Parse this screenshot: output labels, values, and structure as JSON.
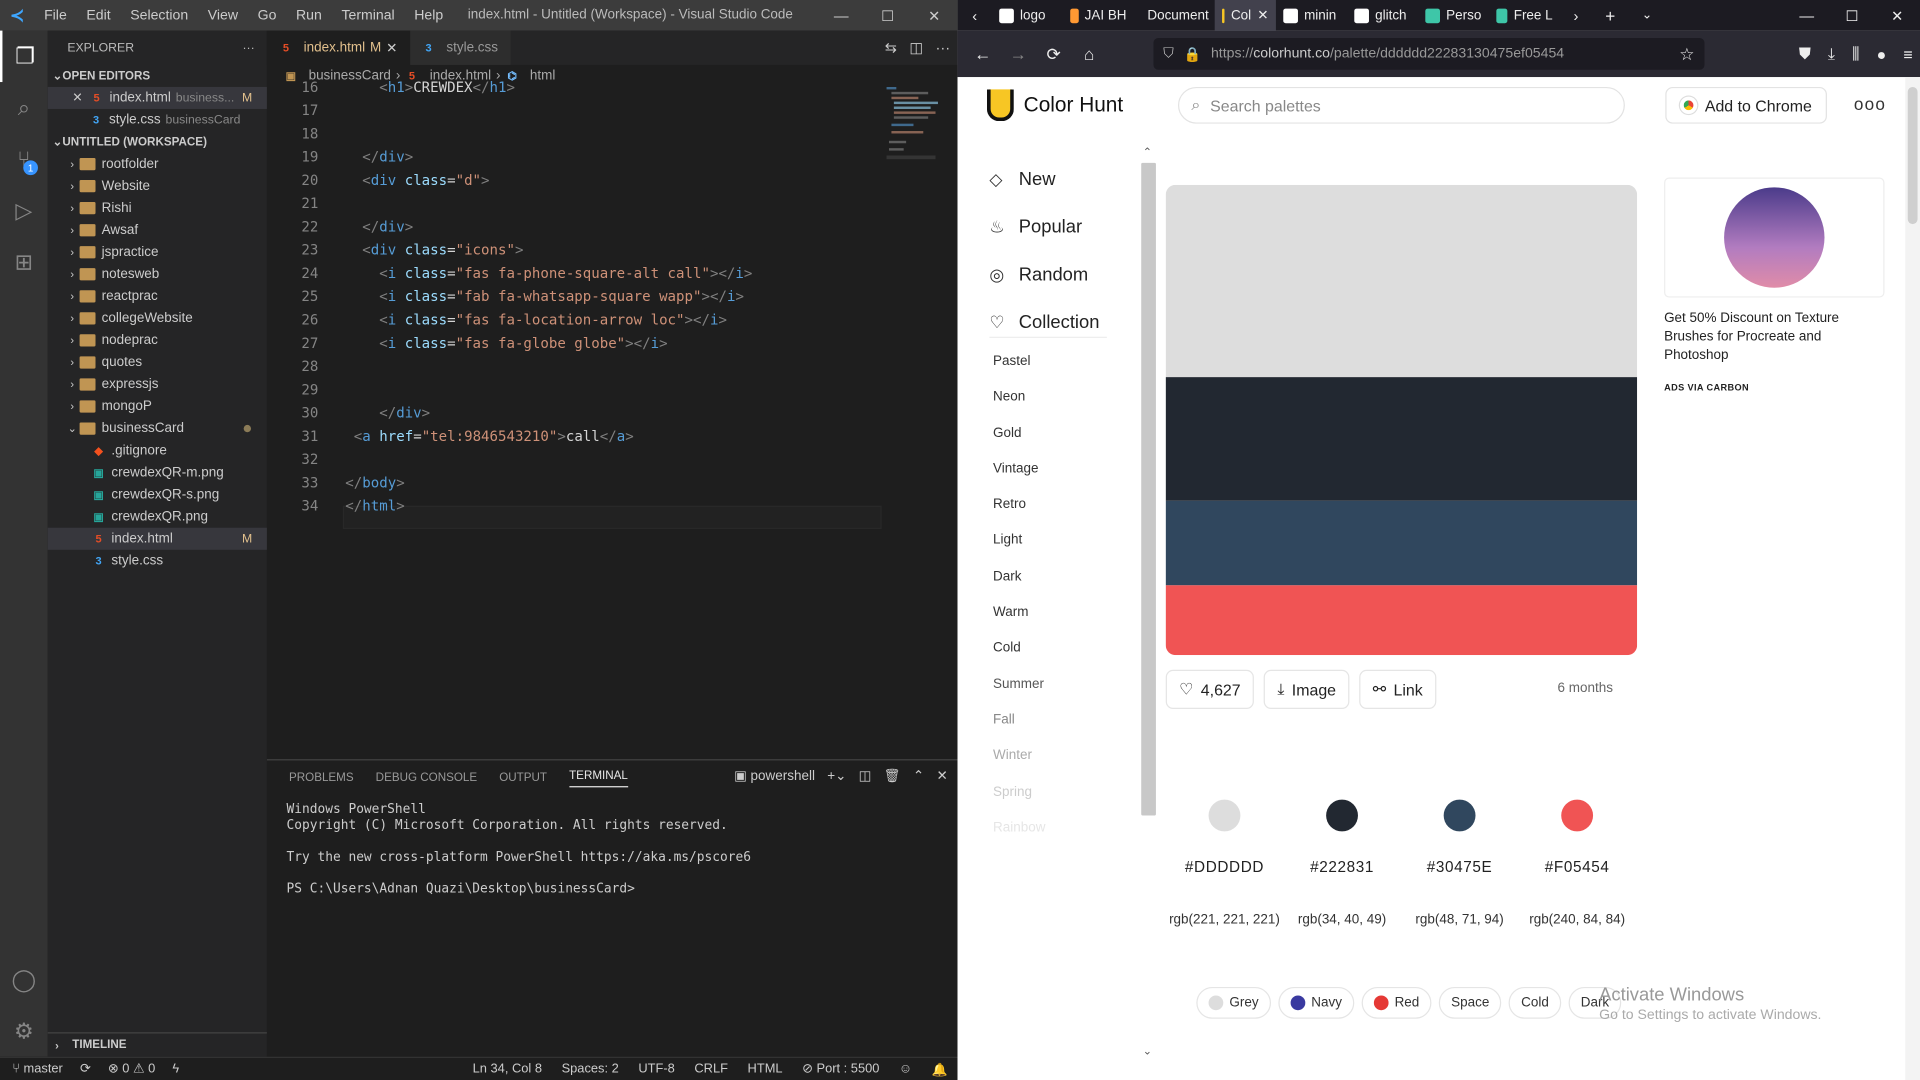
{
  "vscode": {
    "menu": [
      "File",
      "Edit",
      "Selection",
      "View",
      "Go",
      "Run",
      "Terminal",
      "Help"
    ],
    "window_title": "index.html - Untitled (Workspace) - Visual Studio Code",
    "explorer_title": "EXPLORER",
    "open_editors_label": "OPEN EDITORS",
    "open_editors": [
      {
        "name": "index.html",
        "desc": "business...",
        "status": "M"
      },
      {
        "name": "style.css",
        "desc": "businessCard",
        "status": ""
      }
    ],
    "workspace_label": "UNTITLED (WORKSPACE)",
    "folders": [
      "rootfolder",
      "Website",
      "Rishi",
      "Awsaf",
      "jspractice",
      "notesweb",
      "reactprac",
      "collegeWebsite",
      "nodeprac",
      "quotes",
      "expressjs",
      "mongoP"
    ],
    "open_folder": "businessCard",
    "files": [
      {
        "name": ".gitignore",
        "status": ""
      },
      {
        "name": "crewdexQR-m.png",
        "status": ""
      },
      {
        "name": "crewdexQR-s.png",
        "status": ""
      },
      {
        "name": "crewdexQR.png",
        "status": ""
      },
      {
        "name": "index.html",
        "status": "M"
      },
      {
        "name": "style.css",
        "status": ""
      }
    ],
    "timeline_label": "TIMELINE",
    "tabs": [
      {
        "label": "index.html",
        "status": "M"
      },
      {
        "label": "style.css",
        "status": ""
      }
    ],
    "breadcrumb": [
      "businessCard",
      "index.html",
      "html"
    ],
    "code_lines": [
      {
        "n": "16",
        "t": "    <h1>CREWDEX</h1>"
      },
      {
        "n": "17",
        "t": ""
      },
      {
        "n": "18",
        "t": ""
      },
      {
        "n": "19",
        "t": "  </div>"
      },
      {
        "n": "20",
        "t": "  <div class=\"d\">"
      },
      {
        "n": "21",
        "t": ""
      },
      {
        "n": "22",
        "t": "  </div>"
      },
      {
        "n": "23",
        "t": "  <div class=\"icons\">"
      },
      {
        "n": "24",
        "t": "    <i class=\"fas fa-phone-square-alt call\"></i>"
      },
      {
        "n": "25",
        "t": "    <i class=\"fab fa-whatsapp-square wapp\"></i>"
      },
      {
        "n": "26",
        "t": "    <i class=\"fas fa-location-arrow loc\"></i>"
      },
      {
        "n": "27",
        "t": "    <i class=\"fas fa-globe globe\"></i>"
      },
      {
        "n": "28",
        "t": ""
      },
      {
        "n": "29",
        "t": ""
      },
      {
        "n": "30",
        "t": "    </div>"
      },
      {
        "n": "31",
        "t": " <a href=\"tel:9846543210\">call</a>"
      },
      {
        "n": "32",
        "t": ""
      },
      {
        "n": "33",
        "t": "</body>"
      },
      {
        "n": "34",
        "t": "</html>"
      }
    ],
    "panel_tabs": [
      "PROBLEMS",
      "DEBUG CONSOLE",
      "OUTPUT",
      "TERMINAL"
    ],
    "active_panel_tab": "TERMINAL",
    "shell": "powershell",
    "terminal_lines": [
      "Windows PowerShell",
      "Copyright (C) Microsoft Corporation. All rights reserved.",
      "",
      "Try the new cross-platform PowerShell https://aka.ms/pscore6",
      "",
      "PS C:\\Users\\Adnan Quazi\\Desktop\\businessCard> "
    ],
    "status": {
      "branch": "master",
      "problems": "0",
      "warnings": "0",
      "position": "Ln 34, Col 8",
      "spaces": "Spaces: 2",
      "encoding": "UTF-8",
      "eol": "CRLF",
      "language": "HTML",
      "port": "Port : 5500"
    },
    "scm_badge": "1"
  },
  "firefox": {
    "tabs": [
      {
        "label": "logo",
        "color": "#ffffff"
      },
      {
        "label": "JAI BH",
        "color": "#ff9933"
      },
      {
        "label": "Document",
        "color": ""
      },
      {
        "label": "Col",
        "color": "#f7c624"
      },
      {
        "label": "minin",
        "color": "#ffffff"
      },
      {
        "label": "glitch",
        "color": "#ffffff"
      },
      {
        "label": "Perso",
        "color": "#3ec6a8"
      },
      {
        "label": "Free L",
        "color": "#3ec6a8"
      }
    ],
    "url_prefix": "https://",
    "url_host": "colorhunt.co",
    "url_path": "/palette/dddddd22283130475ef05454"
  },
  "colorhunt": {
    "brand": "Color Hunt",
    "search_placeholder": "Search palettes",
    "add_to_chrome": "Add to Chrome",
    "nav": [
      {
        "label": "New",
        "icon": "diamond-icon"
      },
      {
        "label": "Popular",
        "icon": "flame-icon"
      },
      {
        "label": "Random",
        "icon": "spiral-icon"
      },
      {
        "label": "Collection",
        "icon": "heart-icon"
      }
    ],
    "tags": [
      {
        "label": "Pastel",
        "color": "#333333"
      },
      {
        "label": "Neon",
        "color": "#333333"
      },
      {
        "label": "Gold",
        "color": "#333333"
      },
      {
        "label": "Vintage",
        "color": "#333333"
      },
      {
        "label": "Retro",
        "color": "#333333"
      },
      {
        "label": "Light",
        "color": "#333333"
      },
      {
        "label": "Dark",
        "color": "#333333"
      },
      {
        "label": "Warm",
        "color": "#333333"
      },
      {
        "label": "Cold",
        "color": "#333333"
      },
      {
        "label": "Summer",
        "color": "#555555"
      },
      {
        "label": "Fall",
        "color": "#888888"
      },
      {
        "label": "Winter",
        "color": "#aaaaaa"
      },
      {
        "label": "Spring",
        "color": "#cccccc"
      },
      {
        "label": "Rainbow",
        "color": "#e6e6e6"
      }
    ],
    "palette": [
      "#DDDDDD",
      "#222831",
      "#30475E",
      "#F05454"
    ],
    "likes": "4,627",
    "image_label": "Image",
    "link_label": "Link",
    "age": "6 months",
    "colors": [
      {
        "hex": "#DDDDDD",
        "rgb": "rgb(221, 221, 221)"
      },
      {
        "hex": "#222831",
        "rgb": "rgb(34, 40, 49)"
      },
      {
        "hex": "#30475E",
        "rgb": "rgb(48, 71, 94)"
      },
      {
        "hex": "#F05454",
        "rgb": "rgb(240, 84, 84)"
      }
    ],
    "chips": [
      {
        "label": "Grey",
        "color": "#dddddd"
      },
      {
        "label": "Navy",
        "color": "#3a3aa0"
      },
      {
        "label": "Red",
        "color": "#e53935"
      },
      {
        "label": "Space",
        "color": ""
      },
      {
        "label": "Cold",
        "color": ""
      },
      {
        "label": "Dark",
        "color": ""
      }
    ],
    "ad_text": "Get 50% Discount on Texture Brushes for Procreate and Photoshop",
    "ad_via": "ADS VIA CARBON"
  },
  "windows_watermark": {
    "line1": "Activate Windows",
    "line2": "Go to Settings to activate Windows."
  }
}
